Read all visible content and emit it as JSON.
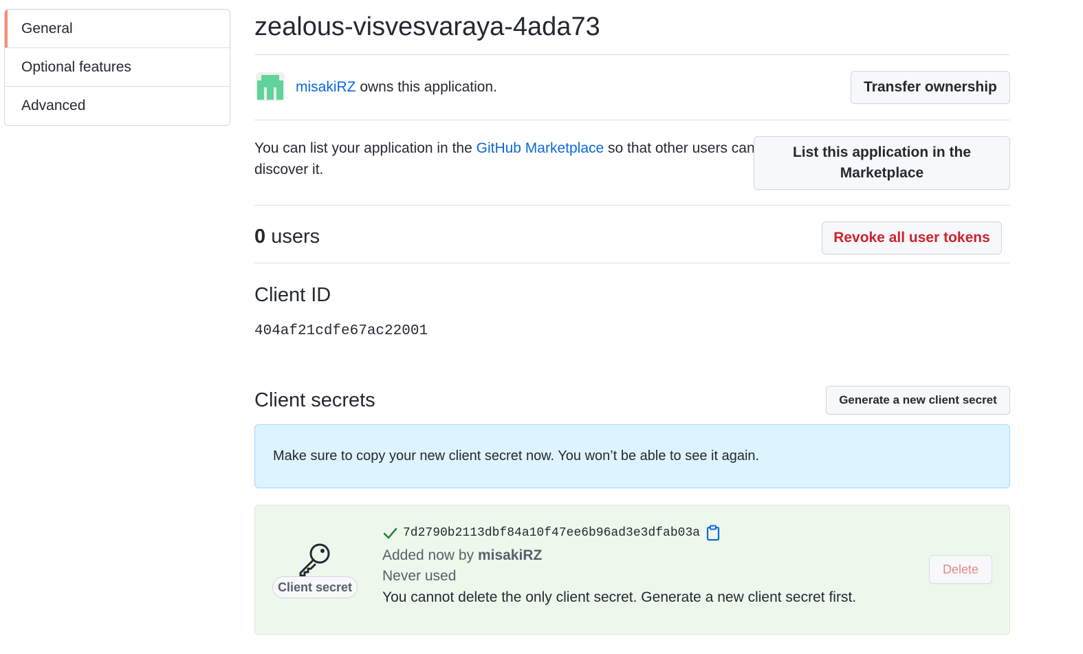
{
  "sidebar": {
    "items": [
      {
        "label": "General",
        "selected": true
      },
      {
        "label": "Optional features",
        "selected": false
      },
      {
        "label": "Advanced",
        "selected": false
      }
    ]
  },
  "app": {
    "title": "zealous-visvesvaraya-4ada73"
  },
  "owner": {
    "username": "misakiRZ",
    "suffix": " owns this application.",
    "transfer_label": "Transfer ownership"
  },
  "marketplace": {
    "text_before": "You can list your application in the ",
    "link_text": "GitHub Marketplace",
    "text_after": " so that other users can discover it.",
    "button_label": "List this application in the Marketplace"
  },
  "users": {
    "count": "0",
    "label": " users",
    "revoke_label": "Revoke all user tokens"
  },
  "client_id": {
    "heading": "Client ID",
    "value": "404af21cdfe67ac22001"
  },
  "client_secrets": {
    "heading": "Client secrets",
    "generate_label": "Generate a new client secret",
    "flash_message": "Make sure to copy your new client secret now. You won’t be able to see it again.",
    "secret": {
      "badge": "Client secret",
      "value": "7d2790b2113dbf84a10f47ee6b96ad3e3dfab03a",
      "added_prefix": "Added now by ",
      "added_by": "misakiRZ",
      "usage": "Never used",
      "note": "You cannot delete the only client secret. Generate a new client secret first.",
      "delete_label": "Delete"
    }
  },
  "colors": {
    "link": "#0969da",
    "danger": "#cf222e",
    "selected_indicator": "#fd8c73",
    "flash_bg": "#ddf4ff",
    "success_bg": "#eef7ec",
    "success_icon": "#1a7f37"
  }
}
